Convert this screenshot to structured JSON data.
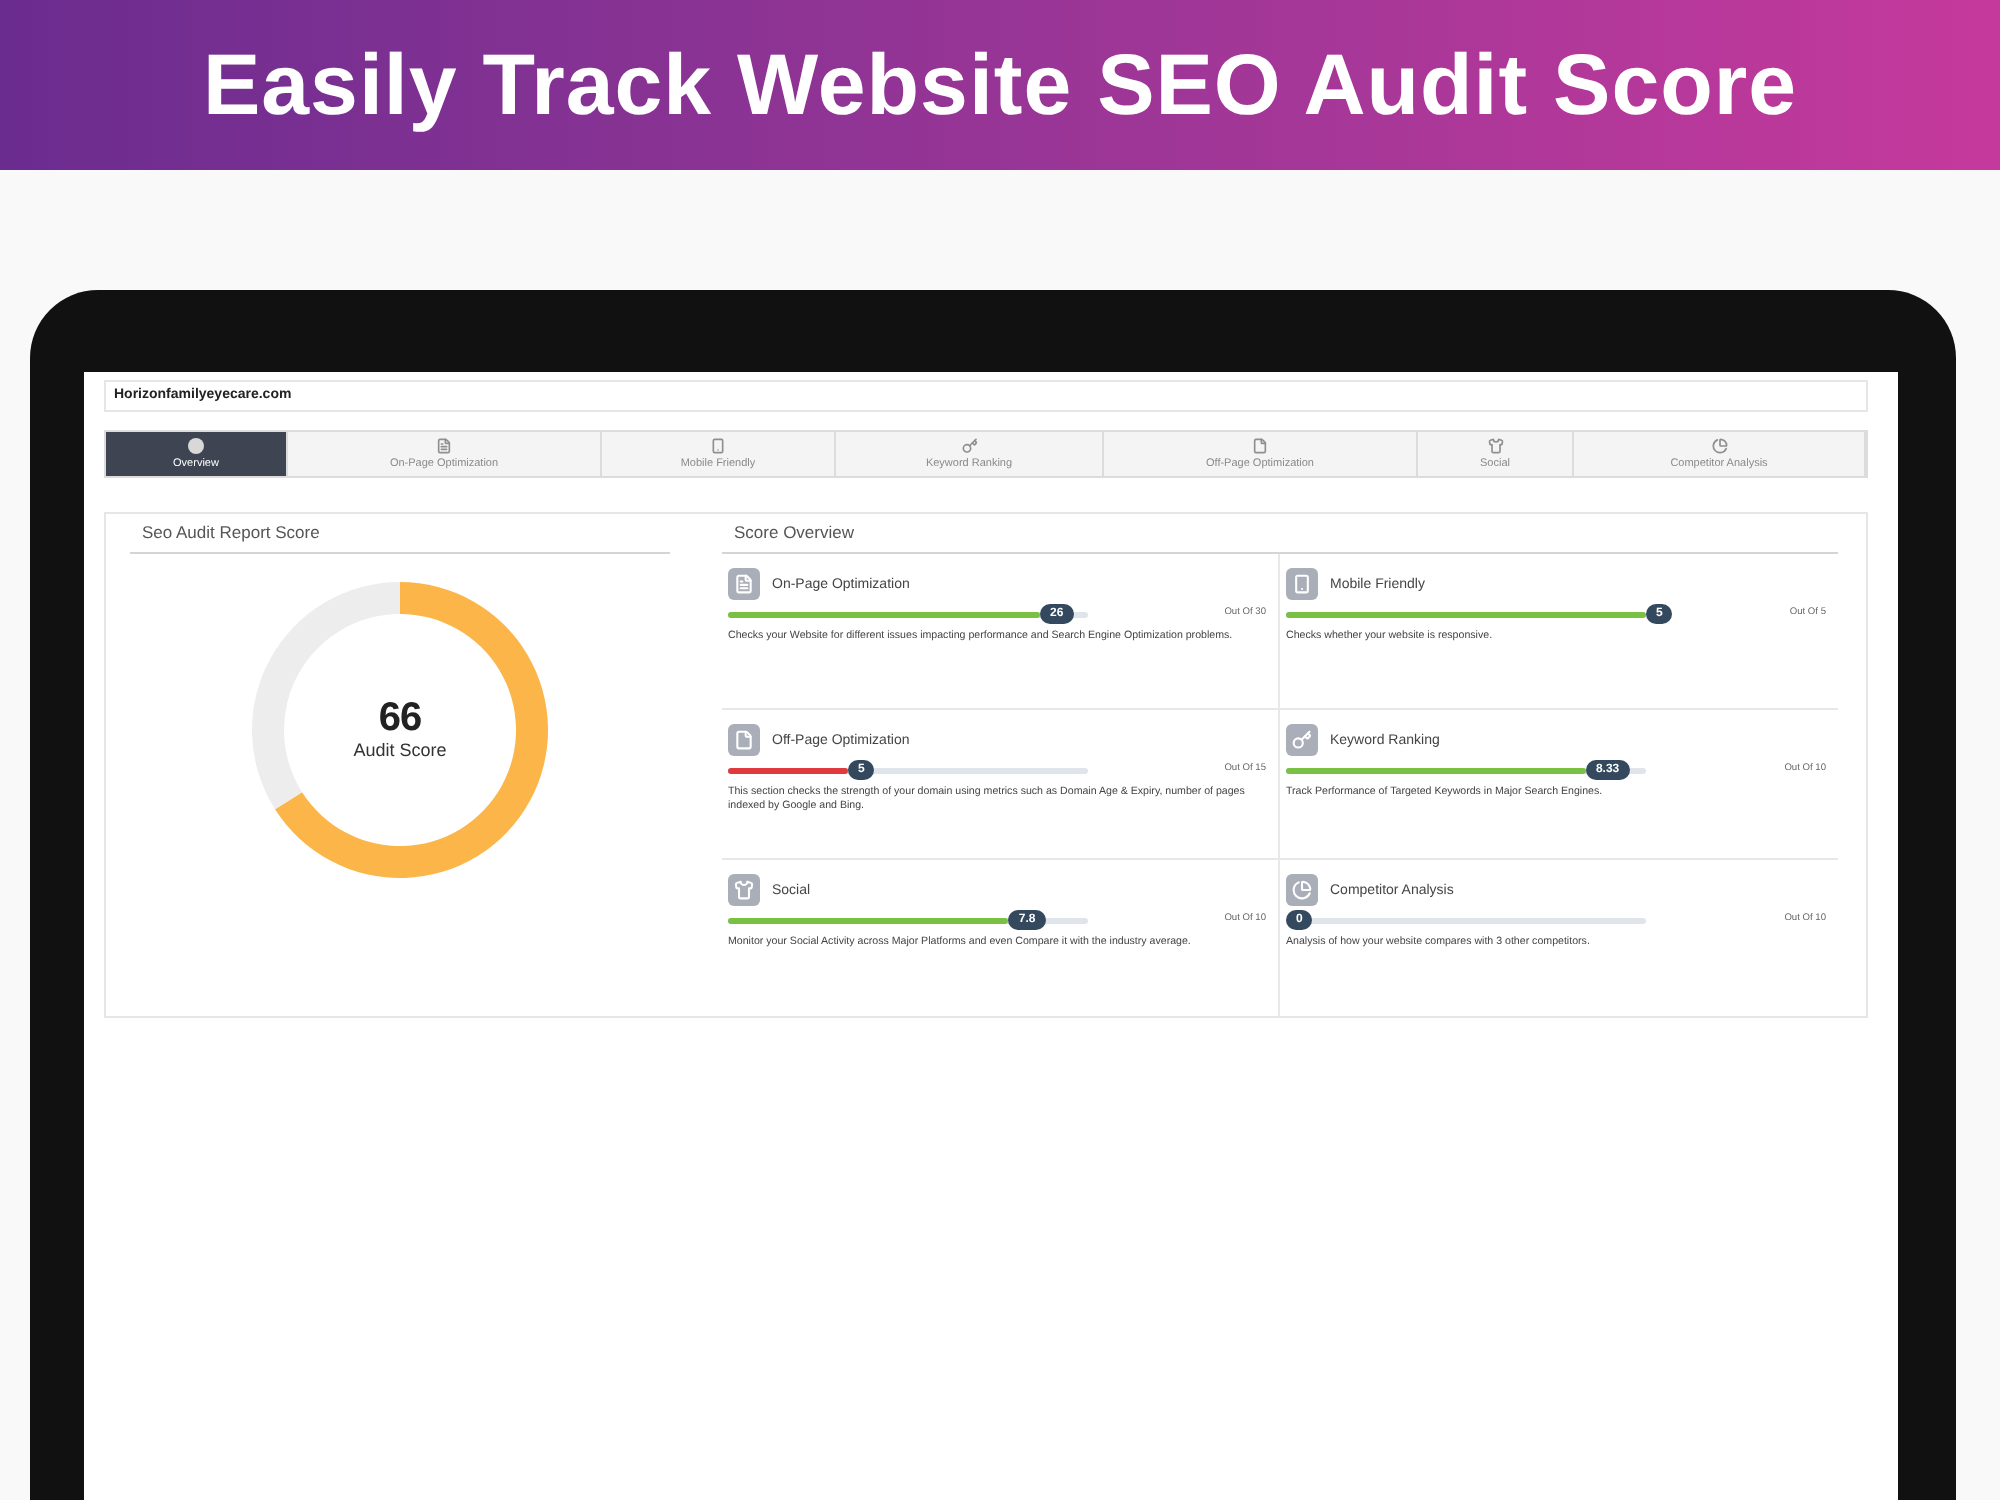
{
  "banner": {
    "title": "Easily Track Website SEO Audit Score"
  },
  "app": {
    "domain": "Horizonfamilyeyecare.com",
    "tabs": [
      {
        "label": "Overview",
        "selected": true
      },
      {
        "label": "On-Page Optimization",
        "selected": false
      },
      {
        "label": "Mobile Friendly",
        "selected": false
      },
      {
        "label": "Keyword Ranking",
        "selected": false
      },
      {
        "label": "Off-Page Optimization",
        "selected": false
      },
      {
        "label": "Social",
        "selected": false
      },
      {
        "label": "Competitor Analysis",
        "selected": false
      }
    ],
    "report_panel": {
      "title": "Seo Audit Report Score",
      "score": "66",
      "score_label": "Audit Score",
      "chart_data": {
        "type": "donut",
        "values": [
          66,
          34
        ]
      }
    },
    "overview_panel": {
      "title": "Score Overview",
      "items": [
        {
          "title": "On-Page Optimization",
          "score": "26",
          "max": "Out Of 30",
          "level": 0.867,
          "color": "#7ac143",
          "description": "Checks your Website for different issues impacting performance and Search Engine Optimization problems."
        },
        {
          "title": "Mobile Friendly",
          "score": "5",
          "max": "Out Of 5",
          "level": 1,
          "color": "#7ac143",
          "description": "Checks whether your website is responsive."
        },
        {
          "title": "Off-Page Optimization",
          "score": "5",
          "max": "Out Of 15",
          "level": 0.333,
          "color": "#e0393e",
          "description": "This section checks the strength of your domain using metrics such as Domain Age & Expiry, number of pages indexed by Google and Bing."
        },
        {
          "title": "Keyword Ranking",
          "score": "8.33",
          "max": "Out Of 10",
          "level": 0.833,
          "color": "#7ac143",
          "description": "Track Performance of Targeted Keywords in Major Search Engines."
        },
        {
          "title": "Social",
          "score": "7.8",
          "max": "Out Of 10",
          "level": 0.78,
          "color": "#7ac143",
          "description": "Monitor your Social Activity across Major Platforms and even Compare it with the industry average."
        },
        {
          "title": "Competitor Analysis",
          "score": "0",
          "max": "Out Of 10",
          "level": 0,
          "description": "Analysis of how your website compares with 3 other competitors."
        }
      ]
    }
  }
}
